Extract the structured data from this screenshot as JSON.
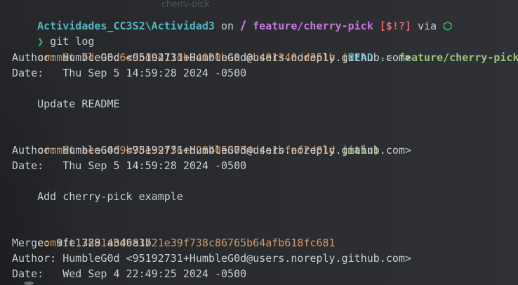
{
  "prompt": {
    "directory": "Actividades_CC3S2\\Actividad3",
    "on_text": " on ",
    "branch_icon": "git-branch-icon",
    "branch": " feature/cherry-pick",
    "status": " [$!?]",
    "via_text": " via ",
    "runtime_icon": "nodejs-icon",
    "runtime_glyph": "⬡"
  },
  "ghost_tab_text": "cherry-pick",
  "command": {
    "arrow": "❯",
    "text": " git log"
  },
  "commits": [
    {
      "label": "commit ",
      "hash": "7de95c6edbde411db94000baad0b481340dd351b",
      "open_paren": " (",
      "head_label": "HEAD",
      "ref_arrow": " -> ",
      "ref": "feature/cherry-pick",
      "close_paren": ")",
      "author": "Author: HumbleG0d <95192731+HumbleG0d@users.noreply.github.com>",
      "date": "Date:   Thu Sep 5 14:59:28 2024 -0500",
      "message": "    Update README"
    },
    {
      "label": "commit ",
      "hash": "aea6469b78e39ff6cd284053754d4a1bfef2d81d",
      "open_paren": " (",
      "ref": "main",
      "close_paren": ")",
      "author": "Author: HumbleG0d <95192731+HumbleG0d@users.noreply.github.com>",
      "date": "Date:   Thu Sep 5 14:59:28 2024 -0500",
      "message": "    Add cherry-pick example"
    },
    {
      "label": "commit ",
      "hash": "78914bd983721e39f738c86765b64afb618fc681",
      "merge": "Merge: 9fe1328 a346a1b",
      "author": "Author: HumbleG0d <95192731+HumbleG0d@users.noreply.github.com>",
      "date": "Date:   Wed Sep 4 22:49:25 2024 -0500"
    }
  ],
  "colors": {
    "directory": "#56b6c2",
    "branch": "#c678dd",
    "status": "#e06c75",
    "commit_hash": "#d19a66",
    "ref_name": "#98c379",
    "prompt_arrow": "#3fbf6f"
  }
}
